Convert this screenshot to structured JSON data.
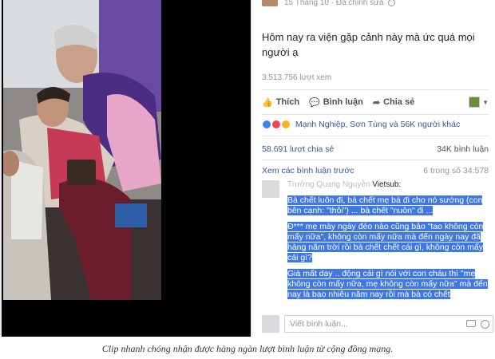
{
  "post": {
    "date": "15 Tháng 10",
    "edited": "Đã chỉnh sửa",
    "message": "Hôm nay ra viện gặp cảnh này mà ức quá mọi người ạ",
    "views": "3.513.756 lượt xem",
    "actions": {
      "like": "Thích",
      "comment": "Bình luận",
      "share": "Chia sẻ"
    },
    "reactions_text": "Mạnh Nghiệp, Sơn Tùng và 56K người khác",
    "shares": "58.691 lượt chia sẻ",
    "comments_count": "34K bình luận",
    "view_previous": "Xem các bình luận trước",
    "previous_count": "6 trong số 34.578",
    "comment": {
      "author": "Trường Quang Nguyễn",
      "suffix": "Vietsub:",
      "paragraphs": [
        "Bà chết luôn đi, bà chết mẹ bà đi cho nó sướng (con bên cạnh: \"thôi\") ... bà chết \"nuôn\" đi ...",
        "Đ*** mẹ mày ngày đéo nào cũng bảo \"tao không còn mấy nữa\", không còn mấy nữa mà đến ngày nay đã hàng năm trời rồi bà chết chết cái gì, không còn mấy cái gì?",
        "Già mất dạy .. động cái gì nói với con cháu thì \"mẹ không còn mấy nữa, mẹ không còn mấy nữa\" mà đến nay là bao nhiêu năm nay rồi mà bà có chết"
      ]
    },
    "input_placeholder": "Viết bình luận..."
  },
  "caption": "Clip nhanh chóng nhận được hàng ngàn lượt bình luận từ cộng đồng mạng.",
  "colors": {
    "link": "#365899",
    "highlight": "#3f78e4",
    "meta": "#90949c"
  },
  "icons": [
    "like-icon",
    "comment-icon",
    "share-icon",
    "globe-icon",
    "camera-icon",
    "emoji-icon"
  ]
}
